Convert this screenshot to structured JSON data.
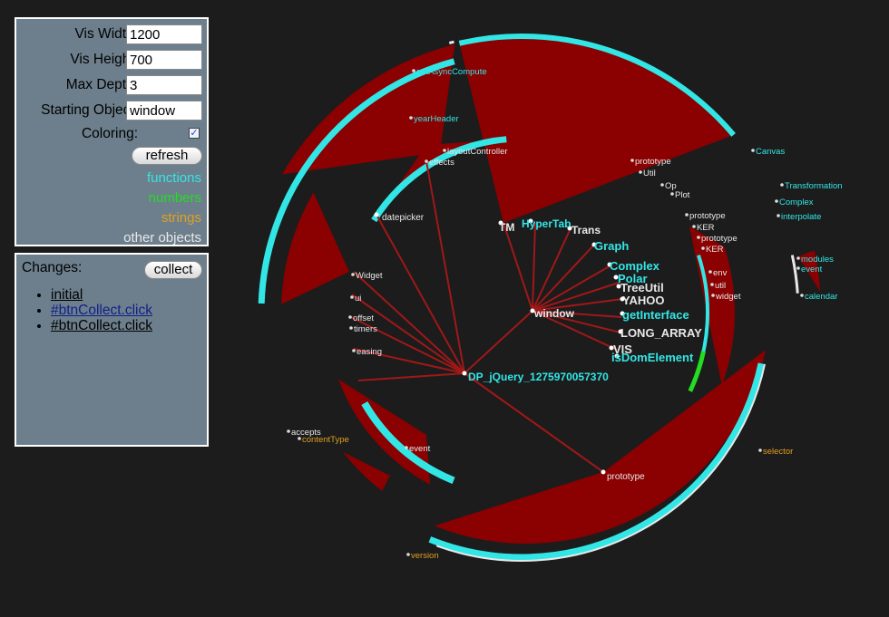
{
  "settings": {
    "vis_width_label": "Vis Width:",
    "vis_width_value": "1200",
    "vis_height_label": "Vis Height:",
    "vis_height_value": "700",
    "max_depth_label": "Max Depth:",
    "max_depth_value": "3",
    "starting_object_label": "Starting Object:",
    "starting_object_value": "window",
    "coloring_label": "Coloring:",
    "coloring_checked": true,
    "refresh_label": "refresh"
  },
  "legend": [
    {
      "label": "functions",
      "color": "#33e6e6"
    },
    {
      "label": "numbers",
      "color": "#22dd22"
    },
    {
      "label": "strings",
      "color": "#e0a020"
    },
    {
      "label": "other objects",
      "color": "#e8e8e8"
    }
  ],
  "changes": {
    "title": "Changes:",
    "collect_label": "collect",
    "items": [
      {
        "label": "initial",
        "color": "#000000"
      },
      {
        "label": "#btnCollect.click",
        "color": "#10208a"
      },
      {
        "label": "#btnCollect.click",
        "color": "#000000"
      }
    ]
  },
  "colors": {
    "background": "#1c1c1c",
    "panel": "#6d7f8c",
    "wedge": "#8b0000",
    "edge": "#a01818",
    "function": "#33e6e6",
    "number": "#22dd22",
    "string": "#e0a020",
    "object": "#e8e8e8"
  },
  "graph": {
    "root": {
      "label": "window",
      "kind": "object"
    },
    "groups": [
      {
        "label": "DP_jQuery_1275970057370",
        "kind": "function"
      },
      {
        "label": "prototype",
        "kind": "object"
      },
      {
        "label": "datepicker",
        "kind": "object"
      },
      {
        "label": "Trans",
        "kind": "object"
      },
      {
        "label": "TM",
        "kind": "object"
      },
      {
        "label": "HyperTab",
        "kind": "function"
      }
    ],
    "window_children": [
      {
        "label": "Graph",
        "kind": "function"
      },
      {
        "label": "Complex",
        "kind": "function"
      },
      {
        "label": "Polar",
        "kind": "function"
      },
      {
        "label": "TreeUtil",
        "kind": "object"
      },
      {
        "label": "YAHOO",
        "kind": "object"
      },
      {
        "label": "getInterface",
        "kind": "function"
      },
      {
        "label": "LONG_ARRAY",
        "kind": "object"
      },
      {
        "label": "VIS",
        "kind": "object"
      },
      {
        "label": "isDomElement",
        "kind": "function"
      }
    ],
    "small_labels": [
      {
        "label": "effects",
        "kind": "object"
      },
      {
        "label": "layoutController",
        "kind": "object"
      },
      {
        "label": "prototype",
        "kind": "object"
      },
      {
        "label": "Util",
        "kind": "object"
      },
      {
        "label": "Op",
        "kind": "object"
      },
      {
        "label": "Plot",
        "kind": "object"
      },
      {
        "label": "prototype",
        "kind": "object"
      },
      {
        "label": "KER",
        "kind": "object"
      },
      {
        "label": "prototype",
        "kind": "object"
      },
      {
        "label": "KER",
        "kind": "object"
      },
      {
        "label": "env",
        "kind": "object"
      },
      {
        "label": "util",
        "kind": "object"
      },
      {
        "label": "widget",
        "kind": "object"
      },
      {
        "label": "Widget",
        "kind": "object"
      },
      {
        "label": "ui",
        "kind": "object"
      },
      {
        "label": "offset",
        "kind": "object"
      },
      {
        "label": "timers",
        "kind": "object"
      },
      {
        "label": "easing",
        "kind": "object"
      },
      {
        "label": "accepts",
        "kind": "object"
      },
      {
        "label": "event",
        "kind": "object"
      },
      {
        "label": "modules",
        "kind": "function"
      },
      {
        "label": "event",
        "kind": "function"
      },
      {
        "label": "calendar",
        "kind": "function"
      },
      {
        "label": "version",
        "kind": "string"
      },
      {
        "label": "contentType",
        "kind": "string"
      },
      {
        "label": "getAsyncCompute",
        "kind": "function"
      },
      {
        "label": "yearHeader",
        "kind": "function"
      },
      {
        "label": "Transformation",
        "kind": "function"
      },
      {
        "label": "interpolate",
        "kind": "function"
      },
      {
        "label": "selector",
        "kind": "string"
      },
      {
        "label": "Canvas",
        "kind": "function"
      },
      {
        "label": "Complex",
        "kind": "function"
      }
    ]
  }
}
